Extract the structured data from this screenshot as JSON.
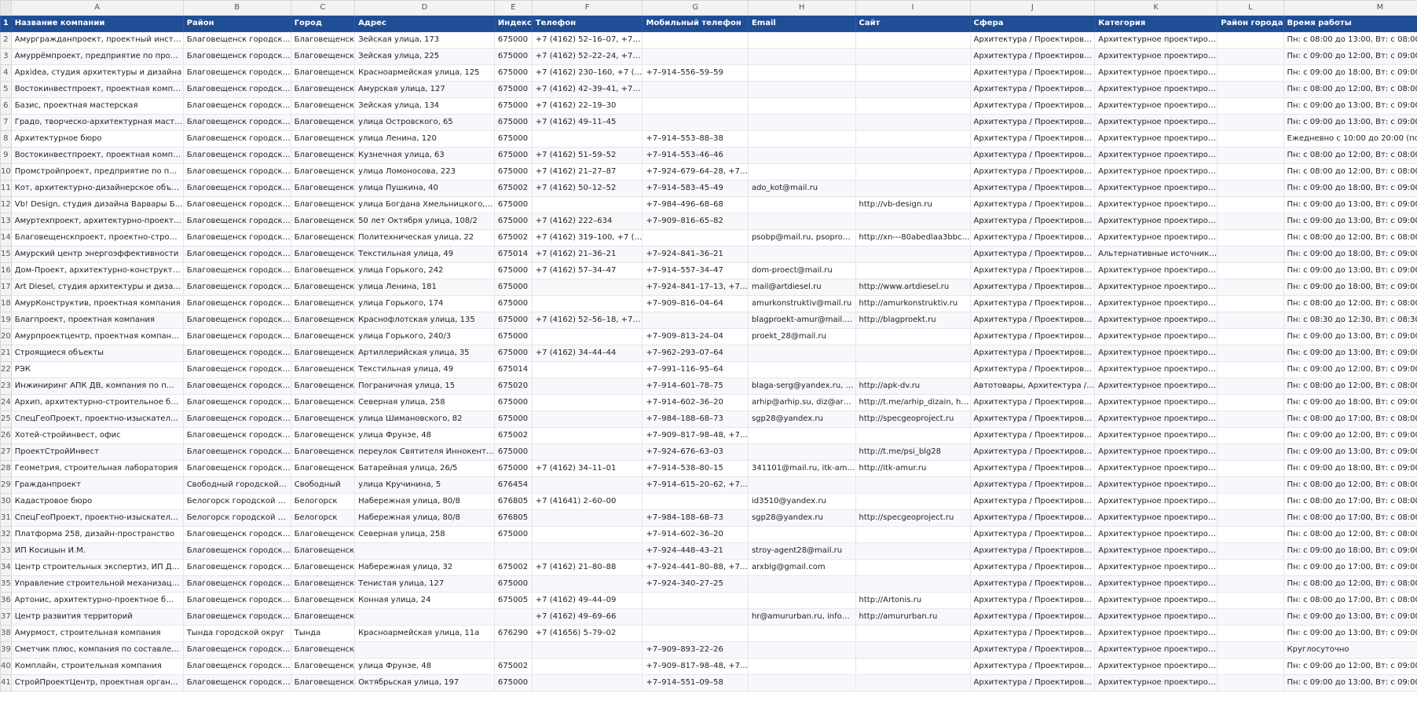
{
  "col_letters": [
    "A",
    "B",
    "C",
    "D",
    "E",
    "F",
    "G",
    "H",
    "I",
    "J",
    "K",
    "L",
    "M"
  ],
  "header_row_number": "1",
  "headers": [
    "Название компании",
    "Район",
    "Город",
    "Адрес",
    "Индекс",
    "Телефон",
    "Мобильный телефон",
    "Email",
    "Сайт",
    "Сфера",
    "Категория",
    "Район города",
    "Время работы"
  ],
  "rows": [
    {
      "n": "2",
      "c": [
        "Амургражданпроект, проектный инст…",
        "Благовещенск городск…",
        "Благовещенск",
        "Зейская улица, 173",
        "675000",
        "+7 (4162) 52–16–07, +7…",
        "",
        "",
        "",
        "Архитектура / Проектиров…",
        "Архитектурное проектиро…",
        "",
        "Пн: с 08:00 до 13:00, Вт: с 08:00 до 13:00, С…"
      ]
    },
    {
      "n": "3",
      "c": [
        "Амуррёмпроект, предприятие по про…",
        "Благовещенск городск…",
        "Благовещенск",
        "Зейская улица, 225",
        "675000",
        "+7 (4162) 52–22–24, +7…",
        "",
        "",
        "",
        "Архитектура / Проектиров…",
        "Архитектурное проектиро…",
        "",
        "Пн: с 09:00 до 12:00, Вт: с 09:00 до 12:00, С…"
      ]
    },
    {
      "n": "4",
      "c": [
        "Apxidea, студия архитектуры и дизайна",
        "Благовещенск городск…",
        "Благовещенск",
        "Красноармейская улица, 125",
        "675000",
        "+7 (4162) 230–160, +7 (…",
        "+7–914–556–59–59",
        "",
        "",
        "Архитектура / Проектиров…",
        "Архитектурное проектиро…",
        "",
        "Пн: с 09:00 до 18:00, Вт: с 09:00 до 18:00, С…"
      ]
    },
    {
      "n": "5",
      "c": [
        "Востокинвестпроект, проектная комп…",
        "Благовещенск городск…",
        "Благовещенск",
        "Амурская улица, 127",
        "675000",
        "+7 (4162) 42–39–41, +7…",
        "",
        "",
        "",
        "Архитектура / Проектиров…",
        "Архитектурное проектиро…",
        "",
        "Пн: с 08:00 до 12:00, Вт: с 08:00 до 12:00, С…"
      ]
    },
    {
      "n": "6",
      "c": [
        "Базис, проектная мастерская",
        "Благовещенск городск…",
        "Благовещенск",
        "Зейская улица, 134",
        "675000",
        "+7 (4162) 22–19–30",
        "",
        "",
        "",
        "Архитектура / Проектиров…",
        "Архитектурное проектиро…",
        "",
        "Пн: с 09:00 до 13:00, Вт: с 09:00 до 13:00, С…"
      ]
    },
    {
      "n": "7",
      "c": [
        "Градо, творческо-архитектурная маст…",
        "Благовещенск городск…",
        "Благовещенск",
        "улица Островского, 65",
        "675000",
        "+7 (4162) 49–11–45",
        "",
        "",
        "",
        "Архитектура / Проектиров…",
        "Архитектурное проектиро…",
        "",
        "Пн: с 09:00 до 13:00, Вт: с 09:00 до 13:00, С…"
      ]
    },
    {
      "n": "8",
      "c": [
        "Архитектурное бюро",
        "Благовещенск городск…",
        "Благовещенск",
        "улица Ленина, 120",
        "675000",
        "",
        "+7–914–553–88–38",
        "",
        "",
        "Архитектура / Проектиров…",
        "Архитектурное проектиро…",
        "",
        "Ежедневно с 10:00 до 20:00 (по предвари…"
      ]
    },
    {
      "n": "9",
      "c": [
        "Востокинвестпроект, проектная комп…",
        "Благовещенск городск…",
        "Благовещенск",
        "Кузнечная улица, 63",
        "675000",
        "+7 (4162) 51–59–52",
        "+7–914–553–46–46",
        "",
        "",
        "Архитектура / Проектиров…",
        "Архитектурное проектиро…",
        "",
        "Пн: с 08:00 до 12:00, Вт: с 08:00 до 12:00, С…"
      ]
    },
    {
      "n": "10",
      "c": [
        "Промстройпроект, предприятие по п…",
        "Благовещенск городск…",
        "Благовещенск",
        "улица Ломоносова, 223",
        "675000",
        "+7 (4162) 21–27–87",
        "+7–924–679–64–28, +7…",
        "",
        "",
        "Архитектура / Проектиров…",
        "Архитектурное проектиро…",
        "",
        "Пн: с 08:00 до 12:00, Вт: с 08:00 до 12:00, С…"
      ]
    },
    {
      "n": "11",
      "c": [
        "Кот, архитектурно-дизайнерское объ…",
        "Благовещенск городск…",
        "Благовещенск",
        "улица Пушкина, 40",
        "675002",
        "+7 (4162) 50–12–52",
        "+7–914–583–45–49",
        "ado_kot@mail.ru",
        "",
        "Архитектура / Проектиров…",
        "Архитектурное проектиро…",
        "",
        "Пн: с 09:00 до 18:00, Вт: с 09:00 до 18:00, С…"
      ]
    },
    {
      "n": "12",
      "c": [
        "Vb! Design, студия дизайна Варвары Б…",
        "Благовещенск городск…",
        "Благовещенск",
        "улица Богдана Хмельницкого,…",
        "675000",
        "",
        "+7–984–496–68–68",
        "",
        "http://vb-design.ru",
        "Архитектура / Проектиров…",
        "Архитектурное проектиро…",
        "",
        "Пн: с 09:00 до 13:00, Вт: с 09:00 до 13:00, С…"
      ]
    },
    {
      "n": "13",
      "c": [
        "Амуртехпроект, архитектурно-проект…",
        "Благовещенск городск…",
        "Благовещенск",
        "50 лет Октября улица, 108/2",
        "675000",
        "+7 (4162) 222–634",
        "+7–909–816–65–82",
        "",
        "",
        "Архитектура / Проектиров…",
        "Архитектурное проектиро…",
        "",
        "Пн: с 09:00 до 13:00, Вт: с 09:00 до 13:00, С…"
      ]
    },
    {
      "n": "14",
      "c": [
        "Благовещенскпроект, проектно-стро…",
        "Благовещенск городск…",
        "Благовещенск",
        "Политехническая улица, 22",
        "675002",
        "+7 (4162) 319–100, +7 (…",
        "",
        "psobp@mail.ru, psopro…",
        "http://xn---80abedlaa3bbc…",
        "Архитектура / Проектиров…",
        "Архитектурное проектиро…",
        "",
        "Пн: с 08:00 до 12:00, Вт: с 08:00 до 12:00, С…"
      ]
    },
    {
      "n": "15",
      "c": [
        "Амурский центр энергоэффективности",
        "Благовещенск городск…",
        "Благовещенск",
        "Текстильная улица, 49",
        "675014",
        "+7 (4162) 21–36–21",
        "+7–924–841–36–21",
        "",
        "",
        "Архитектура / Проектиров…",
        "Альтернативные источник…",
        "",
        "Пн: с 09:00 до 18:00, Вт: с 09:00 до 18:00, С…"
      ]
    },
    {
      "n": "16",
      "c": [
        "Дом-Проект, архитектурно-конструкт…",
        "Благовещенск городск…",
        "Благовещенск",
        "улица Горького, 242",
        "675000",
        "+7 (4162) 57–34–47",
        "+7–914–557–34–47",
        "dom-proect@mail.ru",
        "",
        "Архитектура / Проектиров…",
        "Архитектурное проектиро…",
        "",
        "Пн: с 09:00 до 13:00, Вт: с 09:00 до 13:00, С…"
      ]
    },
    {
      "n": "17",
      "c": [
        "Art Diesel, студия архитектуры и диза…",
        "Благовещенск городск…",
        "Благовещенск",
        "улица Ленина, 181",
        "675000",
        "",
        "+7–924–841–17–13, +7…",
        "mail@artdiesel.ru",
        "http://www.artdiesel.ru",
        "Архитектура / Проектиров…",
        "Архитектурное проектиро…",
        "",
        "Пн: с 09:00 до 18:00, Вт: с 09:00 до 18:00, С…"
      ]
    },
    {
      "n": "18",
      "c": [
        "АмурКонструктив, проектная компания",
        "Благовещенск городск…",
        "Благовещенск",
        "улица Горького, 174",
        "675000",
        "",
        "+7–909–816–04–64",
        "amurkonstruktiv@mail.ru",
        "http://amurkonstruktiv.ru",
        "Архитектура / Проектиров…",
        "Архитектурное проектиро…",
        "",
        "Пн: с 08:00 до 12:00, Вт: с 08:00 до 12:00, С…"
      ]
    },
    {
      "n": "19",
      "c": [
        "Благпроект, проектная компания",
        "Благовещенск городск…",
        "Благовещенск",
        "Краснофлотская улица, 135",
        "675000",
        "+7 (4162) 52–56–18, +7…",
        "",
        "blagproekt-amur@mail.…",
        "http://blagproekt.ru",
        "Архитектура / Проектиров…",
        "Архитектурное проектиро…",
        "",
        "Пн: с 08:30 до 12:30, Вт: с 08:30 до 12:30, С…"
      ]
    },
    {
      "n": "20",
      "c": [
        "Амурпроектцентр, проектная компан…",
        "Благовещенск городск…",
        "Благовещенск",
        "улица Горького, 240/3",
        "675000",
        "",
        "+7–909–813–24–04",
        "proekt_28@mail.ru",
        "",
        "Архитектура / Проектиров…",
        "Архитектурное проектиро…",
        "",
        "Пн: с 09:00 до 13:00, Вт: с 09:00 до 13:00, С…"
      ]
    },
    {
      "n": "21",
      "c": [
        "Строящиеся объекты",
        "Благовещенск городск…",
        "Благовещенск",
        "Артиллерийская улица, 35",
        "675000",
        "+7 (4162) 34–44–44",
        "+7–962–293–07–64",
        "",
        "",
        "Архитектура / Проектиров…",
        "Архитектурное проектиро…",
        "",
        "Пн: с 09:00 до 13:00, Вт: с 09:00 до 13:00, С…"
      ]
    },
    {
      "n": "22",
      "c": [
        "РЭК",
        "Благовещенск городск…",
        "Благовещенск",
        "Текстильная улица, 49",
        "675014",
        "",
        "+7–991–116–95–64",
        "",
        "",
        "Архитектура / Проектиров…",
        "Архитектурное проектиро…",
        "",
        "Пн: с 09:00 до 12:00, Вт: с 09:00 до 12:00, С…"
      ]
    },
    {
      "n": "23",
      "c": [
        "Инжиниринг АПК ДВ, компания по п…",
        "Благовещенск городск…",
        "Благовещенск",
        "Пограничная улица, 15",
        "675020",
        "",
        "+7–914–601–78–75",
        "blaga-serg@yandex.ru, …",
        "http://apk-dv.ru",
        "Автотовары, Архитектура /…",
        "Архитектурное проектиро…",
        "",
        "Пн: с 08:00 до 12:00, Вт: с 08:00 до 12:00, С…"
      ]
    },
    {
      "n": "24",
      "c": [
        "Архип, архитектурно-строительное б…",
        "Благовещенск городск…",
        "Благовещенск",
        "Северная улица, 258",
        "675000",
        "",
        "+7–914–602–36–20",
        "arhip@arhip.su, diz@ar…",
        "http://t.me/arhip_dizain, h…",
        "Архитектура / Проектиров…",
        "Архитектурное проектиро…",
        "",
        "Пн: с 09:00 до 18:00, Вт: с 09:00 до 18:00, С…"
      ]
    },
    {
      "n": "25",
      "c": [
        "СпецГеоПроект, проектно-изыскател…",
        "Благовещенск городск…",
        "Благовещенск",
        "улица Шимановского, 82",
        "675000",
        "",
        "+7–984–188–68–73",
        "sgp28@yandex.ru",
        "http://specgeoproject.ru",
        "Архитектура / Проектиров…",
        "Архитектурное проектиро…",
        "",
        "Пн: с 08:00 до 17:00, Вт: с 08:00 до 17:00, С…"
      ]
    },
    {
      "n": "26",
      "c": [
        "Хотей-стройинвест, офис",
        "Благовещенск городск…",
        "Благовещенск",
        "улица Фрунзе, 48",
        "675002",
        "",
        "+7–909–817–98–48, +7…",
        "",
        "",
        "Архитектура / Проектиров…",
        "Архитектурное проектиро…",
        "",
        "Пн: с 09:00 до 12:00, Вт: с 09:00 до 12:00, С…"
      ]
    },
    {
      "n": "27",
      "c": [
        "ПроектСтройИнвест",
        "Благовещенск городск…",
        "Благовещенск",
        "переулок Святителя Иннокент…",
        "675000",
        "",
        "+7–924–676–63–03",
        "",
        "http://t.me/psi_blg28",
        "Архитектура / Проектиров…",
        "Архитектурное проектиро…",
        "",
        "Пн: с 09:00 до 13:00, Вт: с 09:00 до 13:00, С…"
      ]
    },
    {
      "n": "28",
      "c": [
        "Геометрия, строительная лаборатория",
        "Благовещенск городск…",
        "Благовещенск",
        "Батарейная улица, 26/5",
        "675000",
        "+7 (4162) 34–11–01",
        "+7–914–538–80–15",
        "341101@mail.ru, itk-am…",
        "http://itk-amur.ru",
        "Архитектура / Проектиров…",
        "Архитектурное проектиро…",
        "",
        "Пн: с 09:00 до 18:00, Вт: с 09:00 до 18:00, С…"
      ]
    },
    {
      "n": "29",
      "c": [
        "Гражданпроект",
        "Свободный городской…",
        "Свободный",
        "улица Кручинина, 5",
        "676454",
        "",
        "+7–914–615–20–62, +7…",
        "",
        "",
        "Архитектура / Проектиров…",
        "Архитектурное проектиро…",
        "",
        "Пн: с 08:00 до 12:00, Вт: с 08:00 до 12:00, С…"
      ]
    },
    {
      "n": "30",
      "c": [
        "Кадастровое бюро",
        "Белогорск городской …",
        "Белогорск",
        "Набережная улица, 80/8",
        "676805",
        "+7 (41641) 2–60–00",
        "",
        "id3510@yandex.ru",
        "",
        "Архитектура / Проектиров…",
        "Архитектурное проектиро…",
        "",
        "Пн: с 08:00 до 17:00, Вт: с 08:00 до 17:00, С…"
      ]
    },
    {
      "n": "31",
      "c": [
        "СпецГеоПроект, проектно-изыскател…",
        "Белогорск городской …",
        "Белогорск",
        "Набережная улица, 80/8",
        "676805",
        "",
        "+7–984–188–68–73",
        "sgp28@yandex.ru",
        "http://specgeoproject.ru",
        "Архитектура / Проектиров…",
        "Архитектурное проектиро…",
        "",
        "Пн: с 08:00 до 17:00, Вт: с 08:00 до 17:00, С…"
      ]
    },
    {
      "n": "32",
      "c": [
        "Платформа 258, дизайн-пространство",
        "Благовещенск городск…",
        "Благовещенск",
        "Северная улица, 258",
        "675000",
        "",
        "+7–914–602–36–20",
        "",
        "",
        "Архитектура / Проектиров…",
        "Архитектурное проектиро…",
        "",
        "Пн: с 08:00 до 12:00, Вт: с 08:00 до 12:00, С…"
      ]
    },
    {
      "n": "33",
      "c": [
        "ИП Косицын И.М.",
        "Благовещенск городск…",
        "Благовещенск",
        "",
        "",
        "",
        "+7–924–448–43–21",
        "stroy-agent28@mail.ru",
        "",
        "Архитектура / Проектиров…",
        "Архитектурное проектиро…",
        "",
        "Пн: с 09:00 до 18:00, Вт: с 09:00 до 18:00, С…"
      ]
    },
    {
      "n": "34",
      "c": [
        "Центр строительных экспертиз, ИП Д…",
        "Благовещенск городск…",
        "Благовещенск",
        "Набережная улица, 32",
        "675002",
        "+7 (4162) 21–80–88",
        "+7–924–441–80–88, +7…",
        "arxblg@gmail.com",
        "",
        "Архитектура / Проектиров…",
        "Архитектурное проектиро…",
        "",
        "Пн: с 09:00 до 17:00, Вт: с 09:00 до 17:00, С…"
      ]
    },
    {
      "n": "35",
      "c": [
        "Управление строительной механизац…",
        "Благовещенск городск…",
        "Благовещенск",
        "Тенистая улица, 127",
        "675000",
        "",
        "+7–924–340–27–25",
        "",
        "",
        "Архитектура / Проектиров…",
        "Архитектурное проектиро…",
        "",
        "Пн: с 08:00 до 12:00, Вт: с 08:00 до 12:00, С…"
      ]
    },
    {
      "n": "36",
      "c": [
        "Артонис, архитектурно-проектное б…",
        "Благовещенск городск…",
        "Благовещенск",
        "Конная улица, 24",
        "675005",
        "+7 (4162) 49–44–09",
        "",
        "",
        "http://Artonis.ru",
        "Архитектура / Проектиров…",
        "Архитектурное проектиро…",
        "",
        "Пн: с 08:00 до 17:00, Вт: с 08:00 до 17:00, С…"
      ]
    },
    {
      "n": "37",
      "c": [
        "Центр развития территорий",
        "Благовещенск городск…",
        "Благовещенск",
        "",
        "",
        "+7 (4162) 49–69–66",
        "",
        "hr@amururban.ru, info…",
        "http://amururban.ru",
        "Архитектура / Проектиров…",
        "Архитектурное проектиро…",
        "",
        "Пн: с 09:00 до 13:00, Вт: с 09:00 до 13:00, С…"
      ]
    },
    {
      "n": "38",
      "c": [
        "Амурмост, строительная компания",
        "Тында городской округ",
        "Тында",
        "Красноармейская улица, 11а",
        "676290",
        "+7 (41656) 5–79–02",
        "",
        "",
        "",
        "Архитектура / Проектиров…",
        "Архитектурное проектиро…",
        "",
        "Пн: с 09:00 до 13:00, Вт: с 09:00 до 13:00, С…"
      ]
    },
    {
      "n": "39",
      "c": [
        "Сметчик плюс, компания по составле…",
        "Благовещенск городск…",
        "Благовещенск",
        "",
        "",
        "",
        "+7–909–893–22–26",
        "",
        "",
        "Архитектура / Проектиров…",
        "Архитектурное проектиро…",
        "",
        "Круглосуточно"
      ]
    },
    {
      "n": "40",
      "c": [
        "Комплайн, строительная компания",
        "Благовещенск городск…",
        "Благовещенск",
        "улица Фрунзе, 48",
        "675002",
        "",
        "+7–909–817–98–48, +7…",
        "",
        "",
        "Архитектура / Проектиров…",
        "Архитектурное проектиро…",
        "",
        "Пн: с 09:00 до 12:00, Вт: с 09:00 до 12:00, С…"
      ]
    },
    {
      "n": "41",
      "c": [
        "СтройПроектЦентр, проектная орган…",
        "Благовещенск городск…",
        "Благовещенск",
        "Октябрьская улица, 197",
        "675000",
        "",
        "+7–914–551–09–58",
        "",
        "",
        "Архитектура / Проектиров…",
        "Архитектурное проектиро…",
        "",
        "Пн: с 09:00 до 13:00, Вт: с 09:00 до 13:00, С…"
      ]
    }
  ]
}
